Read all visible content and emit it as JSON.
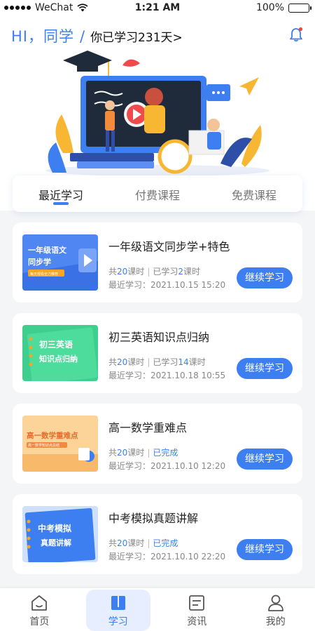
{
  "status_bar": {
    "carrier": "WeChat",
    "time": "1:21 AM",
    "battery": "100%"
  },
  "header": {
    "greeting": "HI，同学",
    "separator": "/",
    "study_days": "你已学习231天>"
  },
  "tabs": [
    {
      "label": "最近学习",
      "active": true
    },
    {
      "label": "付费课程",
      "active": false
    },
    {
      "label": "免费课程",
      "active": false
    }
  ],
  "courses": [
    {
      "title": "一年级语文同步学+特色",
      "thumb_line1": "一年级语文",
      "thumb_line2": "同步学",
      "thumb_tag": "每天观看全力推荐",
      "total_prefix": "共",
      "total": "20",
      "total_unit": "课时",
      "progress_prefix": "已学习",
      "progress": "2",
      "progress_unit": "课时",
      "recent": "最近学习：2021.10.15  15:20",
      "button": "继续学习"
    },
    {
      "title": "初三英语知识点归纳",
      "thumb_line1": "初三英语",
      "thumb_line2": "知识点归纳",
      "total_prefix": "共",
      "total": "20",
      "total_unit": "课时",
      "progress_prefix": "已学习",
      "progress": "14",
      "progress_unit": "课时",
      "recent": "最近学习：2021.10.18  10:55",
      "button": "继续学习"
    },
    {
      "title": "高一数学重难点",
      "thumb_line1": "高一数学重难点",
      "thumb_tag": "高一数学知识点总结",
      "total_prefix": "共",
      "total": "20",
      "total_unit": "课时",
      "status": "已完成",
      "recent": "最近学习：2021.10.10  12:20",
      "button": "继续学习"
    },
    {
      "title": "中考模拟真题讲解",
      "thumb_line1": "中考模拟",
      "thumb_line2": "真题讲解",
      "total_prefix": "共",
      "total": "20",
      "total_unit": "课时",
      "status": "已完成",
      "recent": "最近学习：2021.10.10  22:20",
      "button": "继续学习"
    }
  ],
  "bottom_nav": [
    {
      "label": "首页",
      "icon": "home-icon",
      "active": false
    },
    {
      "label": "学习",
      "icon": "book-icon",
      "active": true
    },
    {
      "label": "资讯",
      "icon": "news-icon",
      "active": false
    },
    {
      "label": "我的",
      "icon": "user-icon",
      "active": false
    }
  ],
  "colors": {
    "accent": "#3d7ff0",
    "background": "#f4f5f7",
    "active_tab_bg": "#e6eeff"
  }
}
